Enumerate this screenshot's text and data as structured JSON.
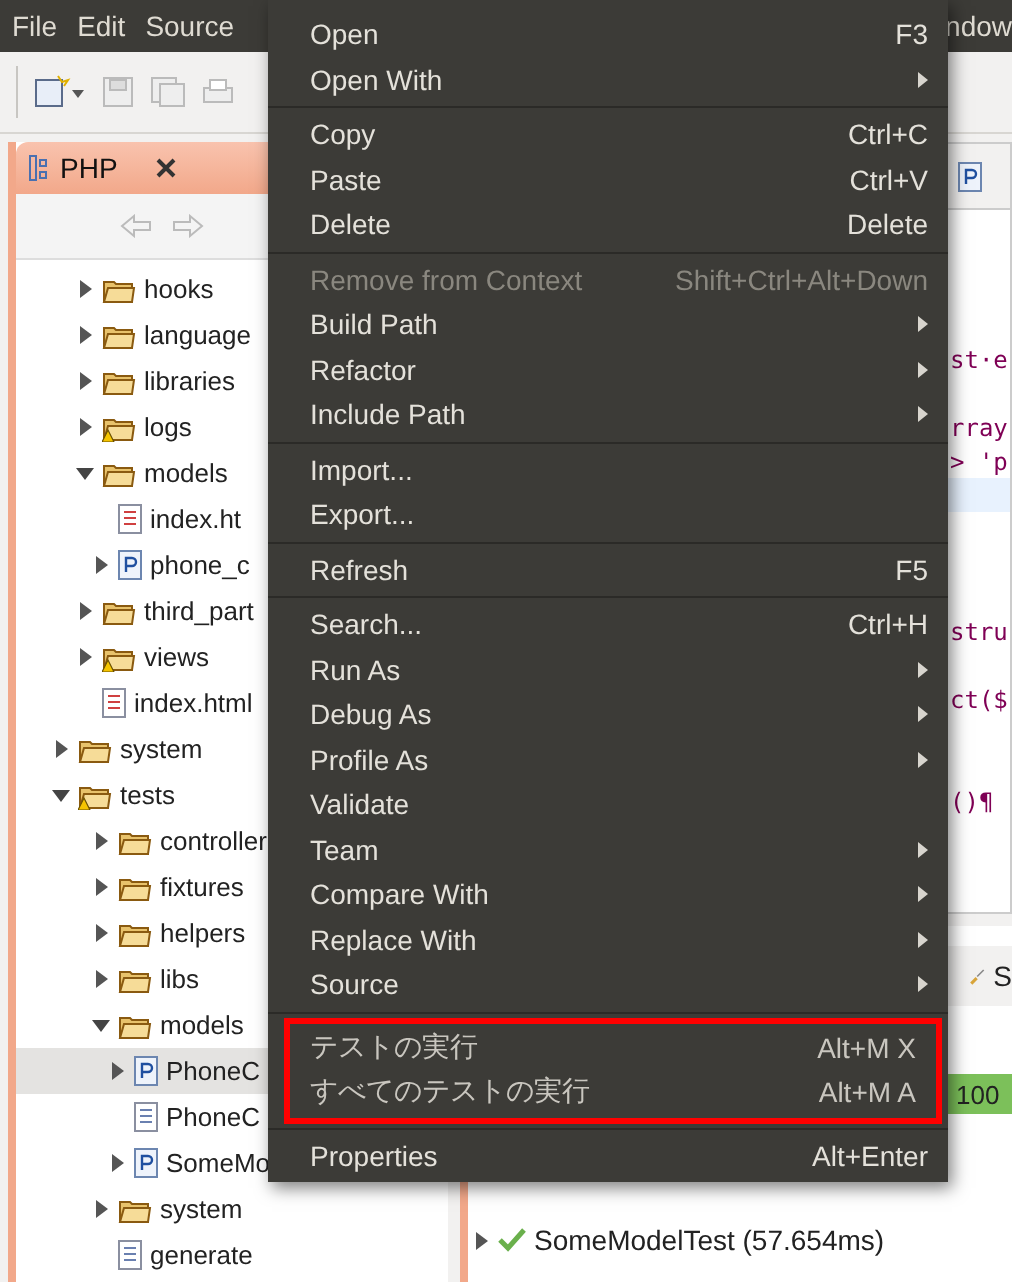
{
  "menubar": {
    "left": [
      "File",
      "Edit",
      "Source"
    ],
    "right": "ndow"
  },
  "php_view": {
    "title": "PHP",
    "tree": [
      {
        "label": "hooks",
        "kind": "folder",
        "expanded": false,
        "warning": false,
        "selected": false
      },
      {
        "label": "language",
        "kind": "folder",
        "expanded": false,
        "warning": false,
        "selected": false
      },
      {
        "label": "libraries",
        "kind": "folder",
        "expanded": false,
        "warning": false,
        "selected": false
      },
      {
        "label": "logs",
        "kind": "folder",
        "expanded": false,
        "warning": true,
        "selected": false
      },
      {
        "label": "models",
        "kind": "folder",
        "expanded": true,
        "warning": false,
        "selected": false,
        "children": [
          {
            "label": "index.ht",
            "kind": "html",
            "selected": false
          },
          {
            "label": "phone_c",
            "kind": "php",
            "expanded": false,
            "selected": false
          }
        ]
      },
      {
        "label": "third_part",
        "kind": "folder",
        "expanded": false,
        "warning": false,
        "selected": false
      },
      {
        "label": "views",
        "kind": "folder",
        "expanded": false,
        "warning": true,
        "selected": false
      },
      {
        "label": "index.html",
        "kind": "html",
        "selected": false
      },
      {
        "label": "system",
        "kind": "folder",
        "expanded": false,
        "warning": false,
        "selected": false,
        "root": true
      },
      {
        "label": "tests",
        "kind": "folder",
        "expanded": true,
        "warning": true,
        "selected": false,
        "root": true,
        "children": [
          {
            "label": "controller",
            "kind": "folder",
            "expanded": false,
            "warning": false,
            "selected": false
          },
          {
            "label": "fixtures",
            "kind": "folder",
            "expanded": false,
            "warning": false,
            "selected": false
          },
          {
            "label": "helpers",
            "kind": "folder",
            "expanded": false,
            "warning": false,
            "selected": false
          },
          {
            "label": "libs",
            "kind": "folder",
            "expanded": false,
            "warning": false,
            "selected": false
          },
          {
            "label": "models",
            "kind": "folder",
            "expanded": true,
            "warning": false,
            "selected": false,
            "children": [
              {
                "label": "PhoneC",
                "kind": "php",
                "expanded": false,
                "selected": true
              },
              {
                "label": "PhoneC",
                "kind": "text",
                "selected": false
              },
              {
                "label": "SomeMo",
                "kind": "php",
                "expanded": false,
                "selected": false
              }
            ]
          },
          {
            "label": "system",
            "kind": "folder",
            "expanded": false,
            "warning": false,
            "selected": false
          },
          {
            "label": "generate",
            "kind": "text",
            "selected": false
          }
        ]
      }
    ]
  },
  "editor": {
    "lines": [
      {
        "kind": "code",
        "text": "st·e"
      },
      {
        "kind": "blank"
      },
      {
        "kind": "code",
        "text": "rray"
      },
      {
        "kind": "code",
        "text": "> 'p"
      },
      {
        "kind": "blank",
        "current": true
      },
      {
        "kind": "blank"
      },
      {
        "kind": "blank"
      },
      {
        "kind": "blank"
      },
      {
        "kind": "code",
        "text": "stru"
      },
      {
        "kind": "blank"
      },
      {
        "kind": "code",
        "text": "ct($"
      },
      {
        "kind": "blank"
      },
      {
        "kind": "blank"
      },
      {
        "kind": "code",
        "text": "()¶"
      }
    ]
  },
  "test_view": {
    "tab": "S",
    "progress": {
      "label": "100",
      "level": 1
    },
    "results": [
      {
        "label": "SomeModelTest (57.654ms)",
        "passed": true
      }
    ]
  },
  "context_menu": {
    "groups": [
      {
        "items": [
          {
            "label": "Open",
            "shortcut": "F3"
          },
          {
            "label": "Open With",
            "submenu": true
          }
        ]
      },
      {
        "items": [
          {
            "label": "Copy",
            "shortcut": "Ctrl+C"
          },
          {
            "label": "Paste",
            "shortcut": "Ctrl+V"
          },
          {
            "label": "Delete",
            "shortcut": "Delete"
          }
        ]
      },
      {
        "items": [
          {
            "label": "Remove from Context",
            "shortcut": "Shift+Ctrl+Alt+Down",
            "disabled": true
          },
          {
            "label": "Build Path",
            "submenu": true
          },
          {
            "label": "Refactor",
            "submenu": true
          },
          {
            "label": "Include Path",
            "submenu": true
          }
        ]
      },
      {
        "items": [
          {
            "label": "Import..."
          },
          {
            "label": "Export..."
          }
        ]
      },
      {
        "items": [
          {
            "label": "Refresh",
            "shortcut": "F5"
          }
        ]
      },
      {
        "items": [
          {
            "label": "Search...",
            "shortcut": "Ctrl+H"
          },
          {
            "label": "Run As",
            "submenu": true
          },
          {
            "label": "Debug As",
            "submenu": true
          },
          {
            "label": "Profile As",
            "submenu": true
          },
          {
            "label": "Validate"
          },
          {
            "label": "Team",
            "submenu": true
          },
          {
            "label": "Compare With",
            "submenu": true
          },
          {
            "label": "Replace With",
            "submenu": true
          },
          {
            "label": "Source",
            "submenu": true
          }
        ]
      },
      {
        "outlined": true,
        "items": [
          {
            "label": "テストの実行",
            "shortcut": "Alt+M X",
            "dim": true
          },
          {
            "label": "すべてのテストの実行",
            "shortcut": "Alt+M A",
            "dim": true
          }
        ]
      },
      {
        "items": [
          {
            "label": "Properties",
            "shortcut": "Alt+Enter"
          }
        ]
      }
    ]
  }
}
